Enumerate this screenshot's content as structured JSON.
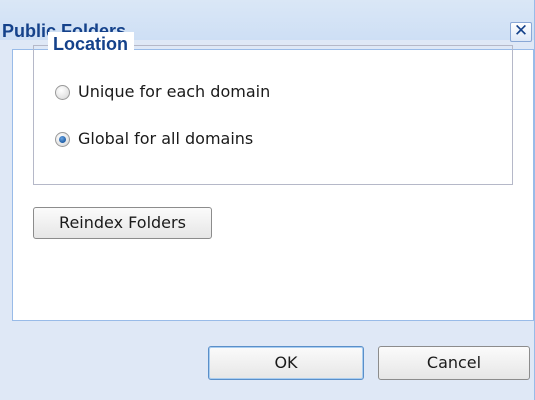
{
  "dialog": {
    "title": "Public Folders",
    "close_icon": "close-icon"
  },
  "location": {
    "legend": "Location",
    "options": [
      {
        "label": "Unique for each domain",
        "checked": false
      },
      {
        "label": "Global for all domains",
        "checked": true
      }
    ]
  },
  "buttons": {
    "reindex": "Reindex Folders",
    "ok": "OK",
    "cancel": "Cancel"
  },
  "colors": {
    "title_text": "#15428b",
    "dialog_bg": "#dfe8f6",
    "panel_border": "#99bbe8"
  }
}
